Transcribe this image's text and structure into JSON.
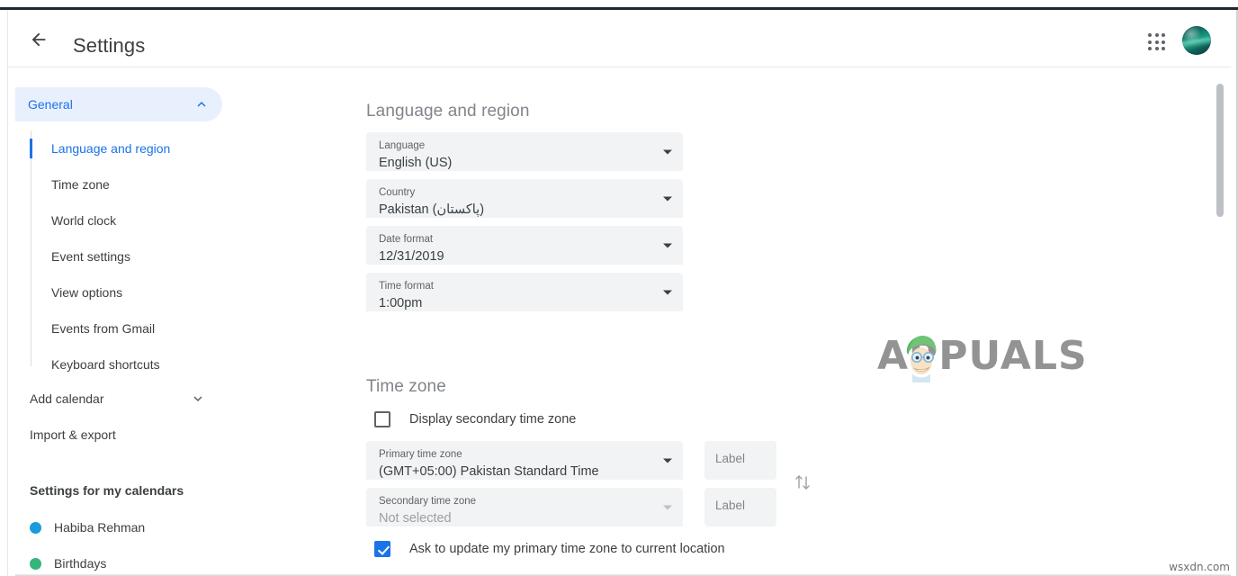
{
  "header": {
    "title": "Settings",
    "back_icon": "arrow-left-icon",
    "apps_icon": "apps-grid-icon",
    "avatar_label": "account-avatar"
  },
  "sidebar": {
    "section": {
      "label": "General",
      "chevron": "chevron-up-icon",
      "expanded": true
    },
    "subitems": [
      {
        "label": "Language and region",
        "active": true
      },
      {
        "label": "Time zone",
        "active": false
      },
      {
        "label": "World clock",
        "active": false
      },
      {
        "label": "Event settings",
        "active": false
      },
      {
        "label": "View options",
        "active": false
      },
      {
        "label": "Events from Gmail",
        "active": false
      },
      {
        "label": "Keyboard shortcuts",
        "active": false
      }
    ],
    "add_calendar": {
      "label": "Add calendar",
      "chevron": "chevron-down-icon"
    },
    "import_export": {
      "label": "Import & export"
    },
    "calendars_heading": "Settings for my calendars",
    "calendars": [
      {
        "name": "Habiba Rehman",
        "color": "#1a9bdb"
      },
      {
        "name": "Birthdays",
        "color": "#33b679"
      }
    ]
  },
  "main": {
    "language_section": {
      "title": "Language and region",
      "fields": [
        {
          "label": "Language",
          "value": "English (US)"
        },
        {
          "label": "Country",
          "value": "Pakistan (پاکستان)"
        },
        {
          "label": "Date format",
          "value": "12/31/2019"
        },
        {
          "label": "Time format",
          "value": "1:00pm"
        }
      ]
    },
    "timezone_section": {
      "title": "Time zone",
      "display_secondary": {
        "label": "Display secondary time zone",
        "checked": false
      },
      "primary": {
        "label": "Primary time zone",
        "value": "(GMT+05:00) Pakistan Standard Time",
        "label_placeholder": "Label"
      },
      "secondary": {
        "label": "Secondary time zone",
        "value": "Not selected",
        "label_placeholder": "Label"
      },
      "swap_icon": "swap-vertical-icon",
      "ask_update": {
        "label": "Ask to update my primary time zone to current location",
        "checked": true
      }
    }
  },
  "watermarks": {
    "center": "APPUALS",
    "corner": "wsxdn.com"
  },
  "colors": {
    "accent": "#1a73e8",
    "accent_bg": "#e8f0fe",
    "field_bg": "#f1f3f4",
    "text": "#3c4043",
    "muted": "#80868b"
  }
}
